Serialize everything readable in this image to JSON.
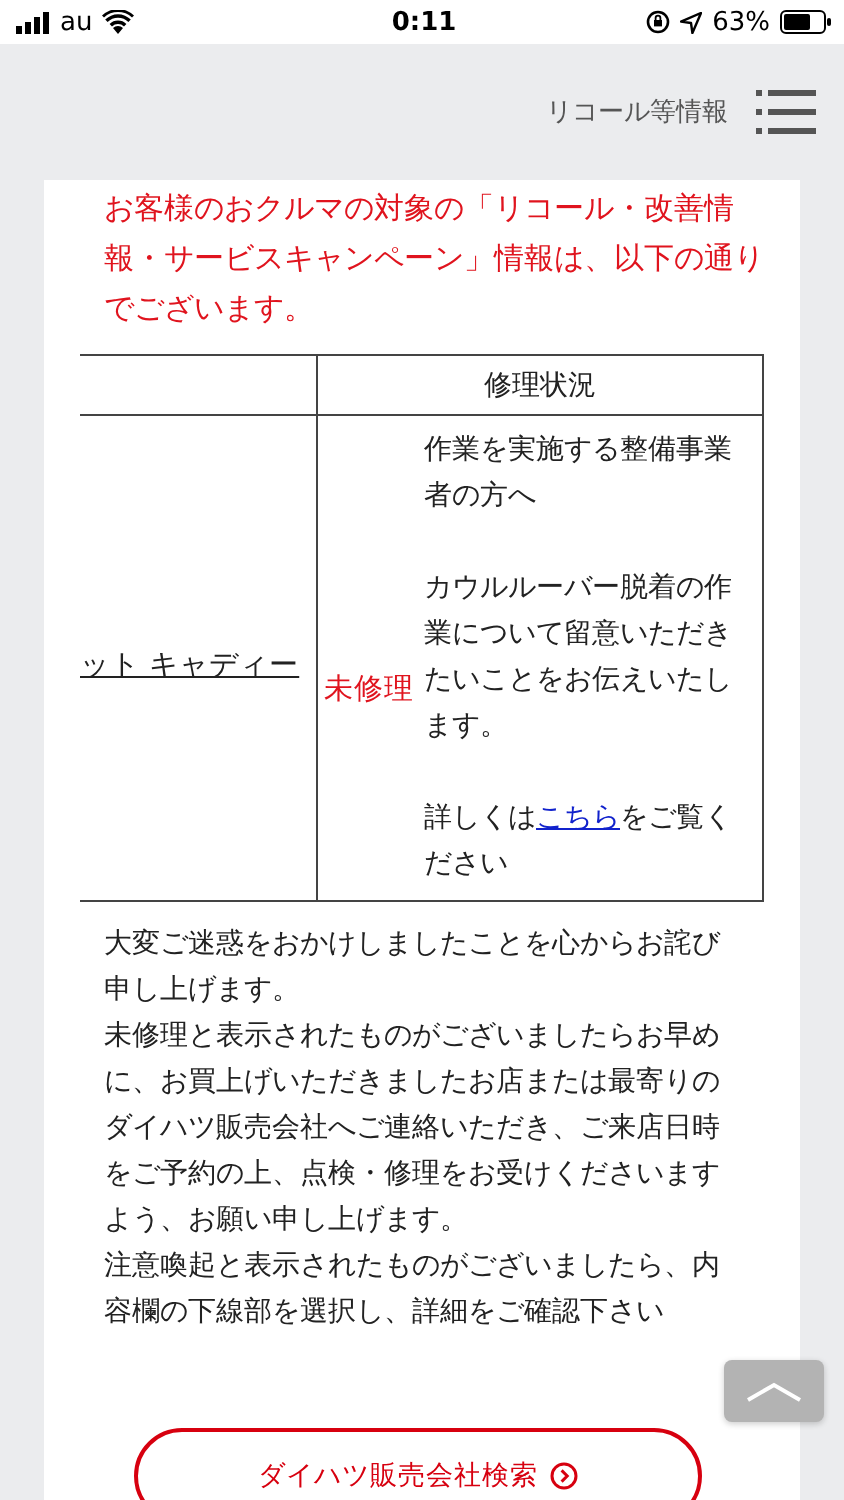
{
  "status_bar": {
    "carrier": "au",
    "time": "0:11",
    "battery": "63%"
  },
  "header": {
    "title": "リコール等情報"
  },
  "intro": "お客様のおクルマの対象の「リコール・改善情報・サービスキャンペーン」情報は、以下の通りでございます。",
  "table": {
    "columns": [
      "修理状況"
    ],
    "rows": [
      {
        "vehicle": "ット キャディー",
        "status": "未修理",
        "details": [
          "作業を実施する整備事業者の方へ",
          "カウルルーバー脱着の作業について留意いただきたいことをお伝えいたします。"
        ],
        "more_prefix": "詳しくは",
        "more_link": "こちら",
        "more_suffix": "をご覧ください"
      }
    ]
  },
  "notes": [
    "大変ご迷惑をおかけしましたことを心からお詫び申し上げます。",
    "未修理と表示されたものがございましたらお早めに、お買上げいただきましたお店または最寄りのダイハツ販売会社へご連絡いただき、ご来店日時をご予約の上、点検・修理をお受けくださいますよう、お願い申し上げます。",
    "注意喚起と表示されたものがございましたら、内容欄の下線部を選択し、詳細をご確認下さい"
  ],
  "dealer_button": "ダイハツ販売会社検索"
}
